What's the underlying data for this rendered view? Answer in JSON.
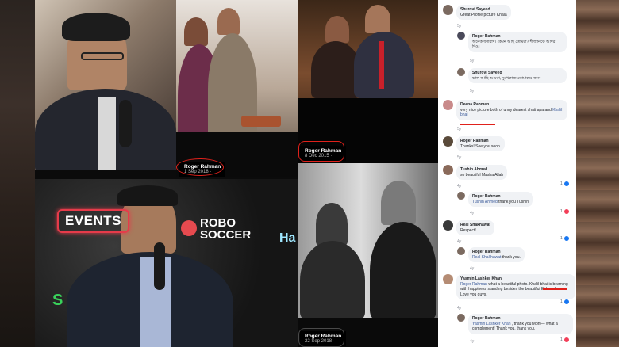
{
  "photos": {
    "top_left": {},
    "top_middle": {
      "name": "Roger Rahman",
      "date": "1 Sep 2018 · "
    },
    "top_right": {
      "name": "Roger Rahman",
      "date": "8 Dec 2015 · "
    },
    "bottom_left": {
      "events_text": "EVENTS",
      "robo_text": "ROBO",
      "soccer_text": "SOCCER",
      "ha_text": "Ha",
      "s_text": "S"
    },
    "bottom_right": {
      "name": "Roger Rahman",
      "date": "22 Sep 2018 · "
    }
  },
  "comments": [
    {
      "author": "Shurovi Sayeed",
      "text": "Great Profile picture Khala",
      "meta": "5y"
    },
    {
      "author": "Roger Rahman",
      "text": "অনেক ধন্যবাদ। কেমন আছ তোমরা? শীজানকে আদর দিও।",
      "meta": "5y"
    },
    {
      "author": "Shurovi Sayeed",
      "text": "ভাল আছি আমরা, দুঃখকাজ তোমাদের জন্য",
      "meta": "5y"
    },
    {
      "author": "Deena Rahman",
      "text": "very nice picture both of u my dearest shati apa and ",
      "tag": "Khalil bhai",
      "meta": "5y"
    },
    {
      "author": "Roger Rahman",
      "text": "Thanks! See you soon.",
      "meta": "5y"
    },
    {
      "author": "Tushin Ahmed",
      "text": "so beautiful Masha Allah",
      "meta": "4y",
      "count": "1"
    },
    {
      "author": "Roger Rahman",
      "tag": "Tushin Ahmed",
      "text": " thank you Tushin.",
      "meta": "4y",
      "count": "1"
    },
    {
      "author": "Real Shakhawat",
      "text": "Respect!",
      "meta": "4y",
      "count": "1"
    },
    {
      "author": "Roger Rahman",
      "tag": "Real Shakhawat",
      "text": " thank you.",
      "meta": "4y"
    },
    {
      "author": "Yasmin Lashker Khan",
      "tag": "Roger Rahman",
      "text": " what a beautiful photo. Khalil bhai is beaming with happiness standing besides the beautiful Eid er chaad. Love you guys. ",
      "meta": "4y",
      "count": "1"
    },
    {
      "author": "Roger Rahman",
      "tag": "Yasmin Lashker Khan",
      "text": " , thank you Moni— what a complement! Thank you, thank you.",
      "meta": "4y",
      "count": "1"
    }
  ],
  "colors": {
    "highlight": "#e0211b",
    "link": "#385898",
    "like": "#1877f2",
    "love": "#f33e58"
  }
}
